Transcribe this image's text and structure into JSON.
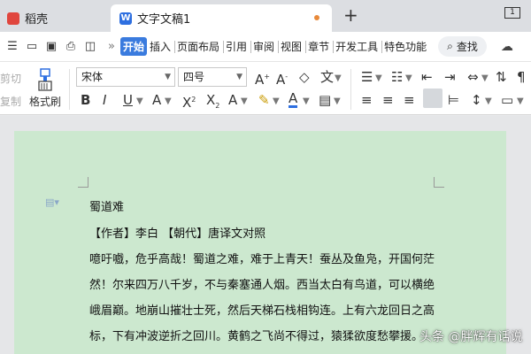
{
  "tabs": {
    "home": "稻壳",
    "doc": "文字文稿1",
    "window_count": "1"
  },
  "menu": {
    "items": [
      "开始",
      "插入",
      "页面布局",
      "引用",
      "审阅",
      "视图",
      "章节",
      "开发工具",
      "特色功能"
    ],
    "search": "查找"
  },
  "ribbon": {
    "cut": "剪切",
    "copy": "复制",
    "format_painter": "格式刷",
    "font_name": "宋体",
    "font_size": "四号",
    "wen": "文"
  },
  "document": {
    "lines": [
      "蜀道难",
      "【作者】李白  【朝代】唐译文对照",
      "噫吁嚱，危乎高哉！蜀道之难，难于上青天！蚕丛及鱼凫，开国何茫",
      "然！尔来四万八千岁，不与秦塞通人烟。西当太白有鸟道，可以横绝",
      "峨眉巅。地崩山摧壮士死，然后天梯石栈相钩连。上有六龙回日之高",
      "标，下有冲波逆折之回川。黄鹤之飞尚不得过，猿猱欲度愁攀援。"
    ]
  },
  "watermark": "头条 @胖辉有话说",
  "colors": {
    "accent": "#3a7bde",
    "page_bg": "#cce8cf",
    "modified_dot": "#e8893a"
  }
}
